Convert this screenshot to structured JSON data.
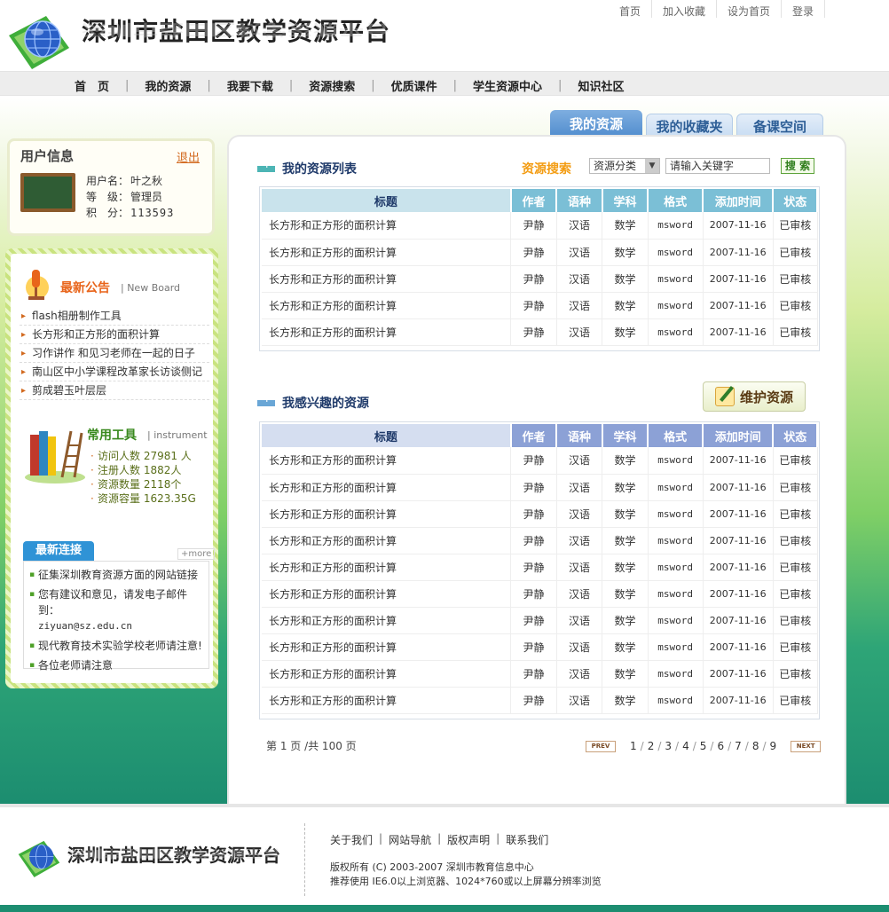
{
  "site": {
    "title": "深圳市盐田区教学资源平台"
  },
  "toplinks": [
    "首页",
    "加入收藏",
    "设为首页",
    "登录"
  ],
  "nav": [
    "首　页",
    "我的资源",
    "我要下载",
    "资源搜索",
    "优质课件",
    "学生资源中心",
    "知识社区"
  ],
  "tabs": [
    {
      "label": "我的资源",
      "active": true
    },
    {
      "label": "我的收藏夹",
      "active": false
    },
    {
      "label": "备课空间",
      "active": false
    }
  ],
  "user": {
    "heading": "用户信息",
    "logout": "退出",
    "fields": [
      {
        "k": "用户名：",
        "v": "叶之秋"
      },
      {
        "k": "等　级：",
        "v": "管理员"
      },
      {
        "k": "积　分：",
        "v": "113593"
      }
    ]
  },
  "notice": {
    "title": "最新公告",
    "sub": "New Board",
    "items": [
      "flash相册制作工具",
      "长方形和正方形的面积计算",
      "习作讲作 和见习老师在一起的日子",
      "南山区中小学课程改革家长访谈侧记",
      "剪成碧玉叶层层"
    ]
  },
  "tools": {
    "title": "常用工具",
    "sub": "instrument",
    "items": [
      "访问人数 27981 人",
      "注册人数 1882人",
      "资源数量 2118个",
      "资源容量 1623.35G"
    ]
  },
  "links": {
    "title": "最新连接",
    "more": "more",
    "items": [
      {
        "text": "征集深圳教育资源方面的网站链接",
        "email": ""
      },
      {
        "text": "您有建议和意见，请发电子邮件到：",
        "email": "ziyuan@sz.edu.cn"
      },
      {
        "text": "现代教育技术实验学校老师请注意!",
        "email": ""
      },
      {
        "text": "各位老师请注意",
        "email": ""
      }
    ]
  },
  "list1": {
    "title": "我的资源列表"
  },
  "search": {
    "label": "资源搜索",
    "select": "资源分类",
    "placeholder": "请输入关键字",
    "button": "搜 索"
  },
  "list2": {
    "title": "我感兴趣的资源",
    "maintain": "维护资源"
  },
  "table": {
    "headers": [
      "标题",
      "作者",
      "语种",
      "学科",
      "格式",
      "添加时间",
      "状态"
    ],
    "row": [
      "长方形和正方形的面积计算",
      "尹静",
      "汉语",
      "数学",
      "msword",
      "2007-11-16",
      "已审核"
    ]
  },
  "list1_rows": 5,
  "list2_rows": 10,
  "pager": {
    "info": "第 1 页 /共 100 页",
    "prev": "PREV",
    "next": "NEXT",
    "pages": [
      "1",
      "2",
      "3",
      "4",
      "5",
      "6",
      "7",
      "8",
      "9"
    ]
  },
  "footer": {
    "links": [
      "关于我们",
      "网站导航",
      "版权声明",
      "联系我们"
    ],
    "copyright": "版权所有 (C) 2003-2007 深圳市教育信息中心",
    "recommend": "推荐使用 IE6.0以上浏览器、1024*760或以上屏幕分辨率浏览"
  },
  "colors": {
    "accent_blue": "#4f8bcd",
    "orange": "#e8641a",
    "green": "#3a8a1f",
    "bg_green": "#1c8d70"
  },
  "icons": [
    "globe-logo-icon",
    "blackboard-icon",
    "microphone-icon",
    "books-ladder-icon",
    "pencil-book-icon"
  ]
}
